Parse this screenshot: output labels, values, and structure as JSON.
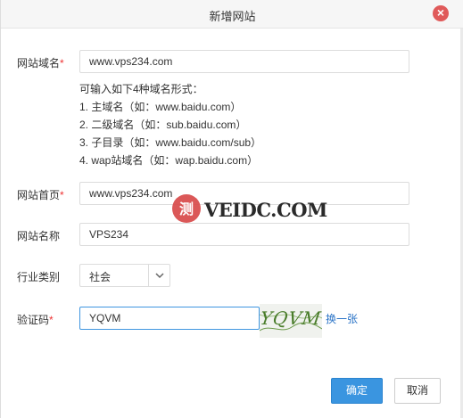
{
  "dialog": {
    "title": "新增网站",
    "close_symbol": "×"
  },
  "form": {
    "domain": {
      "label": "网站域名",
      "required_mark": "*",
      "value": "www.vps234.com"
    },
    "hints": {
      "intro": "可输入如下4种域名形式：",
      "items": [
        "1. 主域名（如：www.baidu.com）",
        "2. 二级域名（如：sub.baidu.com）",
        "3. 子目录（如：www.baidu.com/sub）",
        "4. wap站域名（如：wap.baidu.com）"
      ]
    },
    "homepage": {
      "label": "网站首页",
      "required_mark": "*",
      "value": "www.vps234.com"
    },
    "site_name": {
      "label": "网站名称",
      "value": "VPS234"
    },
    "industry": {
      "label": "行业类别",
      "selected": "社会"
    },
    "captcha": {
      "label": "验证码",
      "required_mark": "*",
      "value": "YQVM",
      "image_text": "YQVM",
      "refresh_label": "换一张"
    }
  },
  "watermark": {
    "logo_char": "测",
    "text": "VEIDC.COM"
  },
  "buttons": {
    "ok_label": "确定",
    "cancel_label": "取消"
  },
  "colors": {
    "primary": "#3a95e0",
    "close": "#e05a5a",
    "required": "#e33333",
    "link": "#2b74c7"
  }
}
